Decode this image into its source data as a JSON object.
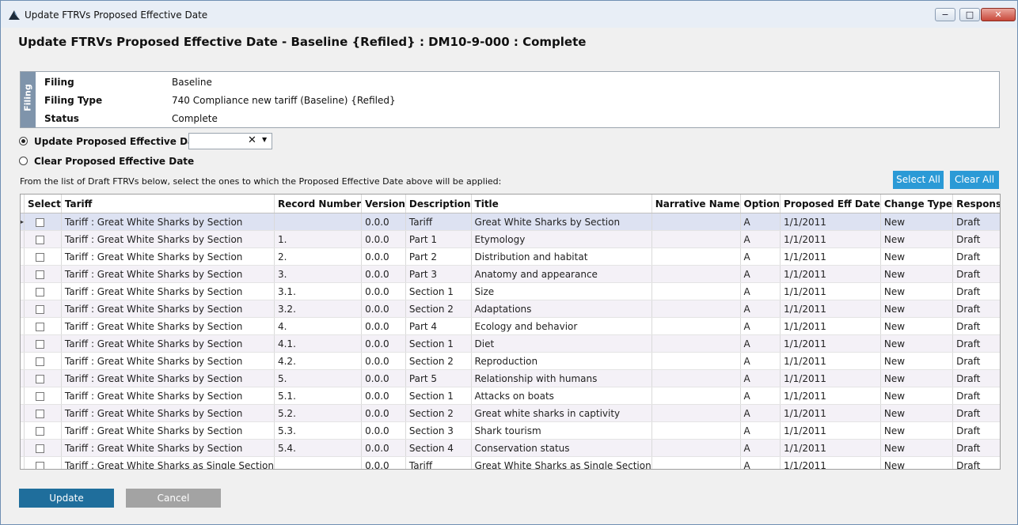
{
  "window": {
    "title": "Update FTRVs Proposed Effective Date",
    "minimize_glyph": "−",
    "maximize_glyph": "□",
    "close_glyph": "✕"
  },
  "page_title": "Update FTRVs Proposed Effective Date - Baseline {Refiled} : DM10-9-000 : Complete",
  "filing": {
    "tab_label": "Filing",
    "rows": [
      {
        "label": "Filing",
        "value": "Baseline"
      },
      {
        "label": "Filing Type",
        "value": "740 Compliance new tariff (Baseline) {Refiled}"
      },
      {
        "label": "Status",
        "value": "Complete"
      }
    ]
  },
  "options": {
    "update_label": "Update Proposed Effective Date:",
    "update_selected": true,
    "clear_label": "Clear Proposed Effective Date",
    "clear_selected": false,
    "date_value": "",
    "clear_glyph": "✕",
    "dropdown_glyph": "▼"
  },
  "instructions": "From the list of Draft FTRVs below, select the ones to which the Proposed Effective Date above will be applied:",
  "actions": {
    "select_all": "Select All",
    "clear_all": "Clear All"
  },
  "grid": {
    "columns": [
      "Select",
      "Tariff",
      "Record Number",
      "Version",
      "Description",
      "Title",
      "Narrative Name",
      "Option",
      "Proposed Eff Date",
      "Change Type",
      "Response"
    ],
    "current_row_indicator": "▸",
    "rows": [
      {
        "tariff": "Tariff : Great White Sharks by Section",
        "record": "",
        "version": "0.0.0",
        "description": "Tariff",
        "title": "Great White Sharks by Section",
        "narrative": "",
        "option": "A",
        "eff_date": "1/1/2011",
        "change": "New",
        "response": "Draft"
      },
      {
        "tariff": "Tariff : Great White Sharks by Section",
        "record": "1.",
        "version": "0.0.0",
        "description": "Part 1",
        "title": "Etymology",
        "narrative": "",
        "option": "A",
        "eff_date": "1/1/2011",
        "change": "New",
        "response": "Draft"
      },
      {
        "tariff": "Tariff : Great White Sharks by Section",
        "record": "2.",
        "version": "0.0.0",
        "description": "Part 2",
        "title": "Distribution and habitat",
        "narrative": "",
        "option": "A",
        "eff_date": "1/1/2011",
        "change": "New",
        "response": "Draft"
      },
      {
        "tariff": "Tariff : Great White Sharks by Section",
        "record": "3.",
        "version": "0.0.0",
        "description": "Part 3",
        "title": "Anatomy and appearance",
        "narrative": "",
        "option": "A",
        "eff_date": "1/1/2011",
        "change": "New",
        "response": "Draft"
      },
      {
        "tariff": "Tariff : Great White Sharks by Section",
        "record": "3.1.",
        "version": "0.0.0",
        "description": "Section 1",
        "title": "Size",
        "narrative": "",
        "option": "A",
        "eff_date": "1/1/2011",
        "change": "New",
        "response": "Draft"
      },
      {
        "tariff": "Tariff : Great White Sharks by Section",
        "record": "3.2.",
        "version": "0.0.0",
        "description": "Section 2",
        "title": "Adaptations",
        "narrative": "",
        "option": "A",
        "eff_date": "1/1/2011",
        "change": "New",
        "response": "Draft"
      },
      {
        "tariff": "Tariff : Great White Sharks by Section",
        "record": "4.",
        "version": "0.0.0",
        "description": "Part 4",
        "title": "Ecology and behavior",
        "narrative": "",
        "option": "A",
        "eff_date": "1/1/2011",
        "change": "New",
        "response": "Draft"
      },
      {
        "tariff": "Tariff : Great White Sharks by Section",
        "record": "4.1.",
        "version": "0.0.0",
        "description": "Section 1",
        "title": "Diet",
        "narrative": "",
        "option": "A",
        "eff_date": "1/1/2011",
        "change": "New",
        "response": "Draft"
      },
      {
        "tariff": "Tariff : Great White Sharks by Section",
        "record": "4.2.",
        "version": "0.0.0",
        "description": "Section 2",
        "title": "Reproduction",
        "narrative": "",
        "option": "A",
        "eff_date": "1/1/2011",
        "change": "New",
        "response": "Draft"
      },
      {
        "tariff": "Tariff : Great White Sharks by Section",
        "record": "5.",
        "version": "0.0.0",
        "description": "Part 5",
        "title": "Relationship with humans",
        "narrative": "",
        "option": "A",
        "eff_date": "1/1/2011",
        "change": "New",
        "response": "Draft"
      },
      {
        "tariff": "Tariff : Great White Sharks by Section",
        "record": "5.1.",
        "version": "0.0.0",
        "description": "Section 1",
        "title": "Attacks on boats",
        "narrative": "",
        "option": "A",
        "eff_date": "1/1/2011",
        "change": "New",
        "response": "Draft"
      },
      {
        "tariff": "Tariff : Great White Sharks by Section",
        "record": "5.2.",
        "version": "0.0.0",
        "description": "Section 2",
        "title": "Great white sharks in captivity",
        "narrative": "",
        "option": "A",
        "eff_date": "1/1/2011",
        "change": "New",
        "response": "Draft"
      },
      {
        "tariff": "Tariff : Great White Sharks by Section",
        "record": "5.3.",
        "version": "0.0.0",
        "description": "Section 3",
        "title": "Shark tourism",
        "narrative": "",
        "option": "A",
        "eff_date": "1/1/2011",
        "change": "New",
        "response": "Draft"
      },
      {
        "tariff": "Tariff : Great White Sharks by Section",
        "record": "5.4.",
        "version": "0.0.0",
        "description": "Section 4",
        "title": "Conservation status",
        "narrative": "",
        "option": "A",
        "eff_date": "1/1/2011",
        "change": "New",
        "response": "Draft"
      },
      {
        "tariff": "Tariff : Great White Sharks as Single Section",
        "record": "",
        "version": "0.0.0",
        "description": "Tariff",
        "title": "Great White Sharks as Single Section",
        "narrative": "",
        "option": "A",
        "eff_date": "1/1/2011",
        "change": "New",
        "response": "Draft"
      }
    ]
  },
  "footer": {
    "update": "Update",
    "cancel": "Cancel"
  },
  "colors": {
    "accent": "#2b9ad6",
    "update_button": "#1f6e9c",
    "cancel_button": "#a3a3a3",
    "filing_tab": "#7f94ab"
  }
}
